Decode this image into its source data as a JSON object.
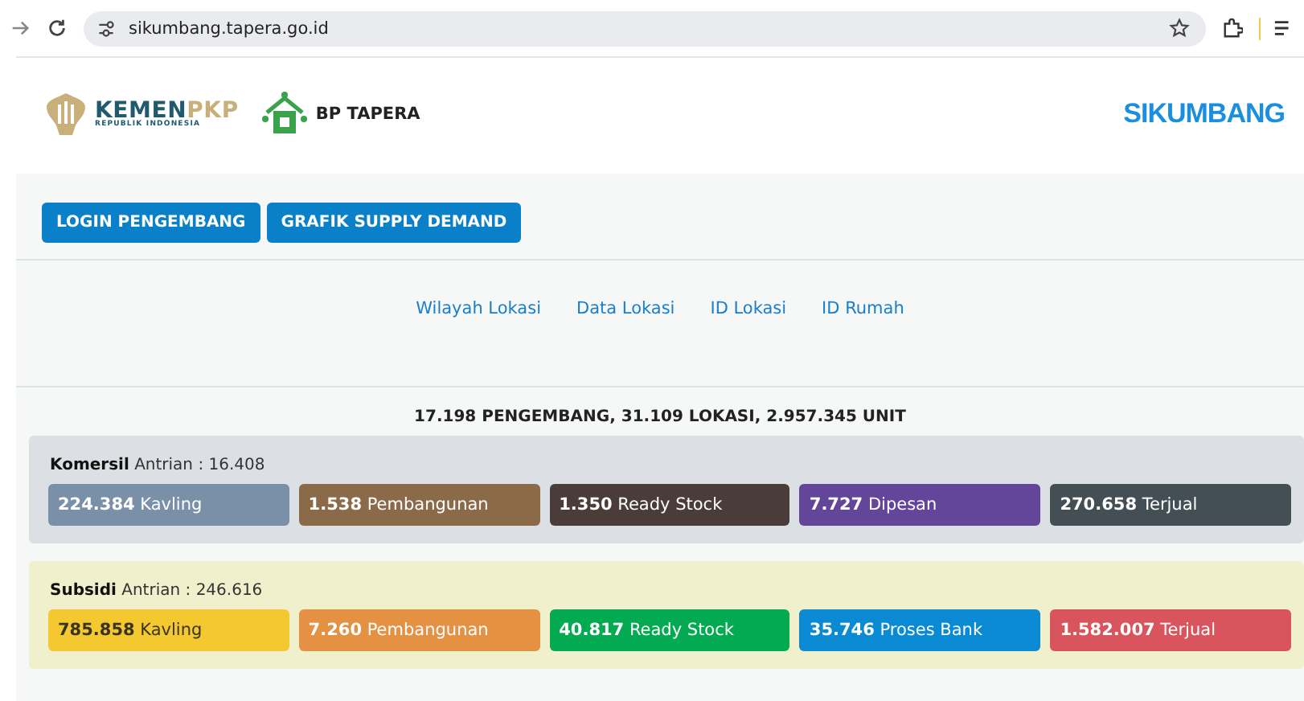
{
  "browser": {
    "url": "sikumbang.tapera.go.id"
  },
  "header": {
    "kemen_logo": {
      "wordmark_parts": [
        "KEMEN",
        "PKP"
      ],
      "subtitle": "REPUBLIK INDONESIA"
    },
    "tapera_logo": {
      "text": "BP TAPERA"
    },
    "site_logo": {
      "text": "SIKUMBANG"
    }
  },
  "buttons": [
    "LOGIN PENGEMBANG",
    "GRAFIK SUPPLY DEMAND"
  ],
  "nav_links": [
    "Wilayah Lokasi",
    "Data Lokasi",
    "ID Lokasi",
    "ID Rumah"
  ],
  "summary": "17.198 PENGEMBANG, 31.109 LOKASI, 2.957.345 UNIT",
  "panels": [
    {
      "title": "**Komersil** Antrian : 16.408",
      "color": "#dcdfe3",
      "stats": [
        {
          "text": "**224.384** Kavling",
          "color": "#7a8fa8"
        },
        {
          "text": "**1.538** Pembangunan",
          "color": "#8b6a4a"
        },
        {
          "text": "**1.350** Ready Stock",
          "color": "#4a3c38"
        },
        {
          "text": "**7.727** Dipesan",
          "color": "#634599"
        },
        {
          "text": "**270.658** Terjual",
          "color": "#434f54"
        }
      ]
    },
    {
      "title": "**Subsidi** Antrian : 246.616",
      "color": "#f1f0cd",
      "stats": [
        {
          "text": "**785.858** Kavling",
          "color": "#f4c831"
        },
        {
          "text": "**7.260** Pembangunan",
          "color": "#e49143"
        },
        {
          "text": "**40.817** Ready Stock",
          "color": "#04aa52"
        },
        {
          "text": "**35.746** Proses Bank",
          "color": "#0a8ad3"
        },
        {
          "text": "**1.582.007** Terjual",
          "color": "#d9555d"
        }
      ]
    }
  ]
}
